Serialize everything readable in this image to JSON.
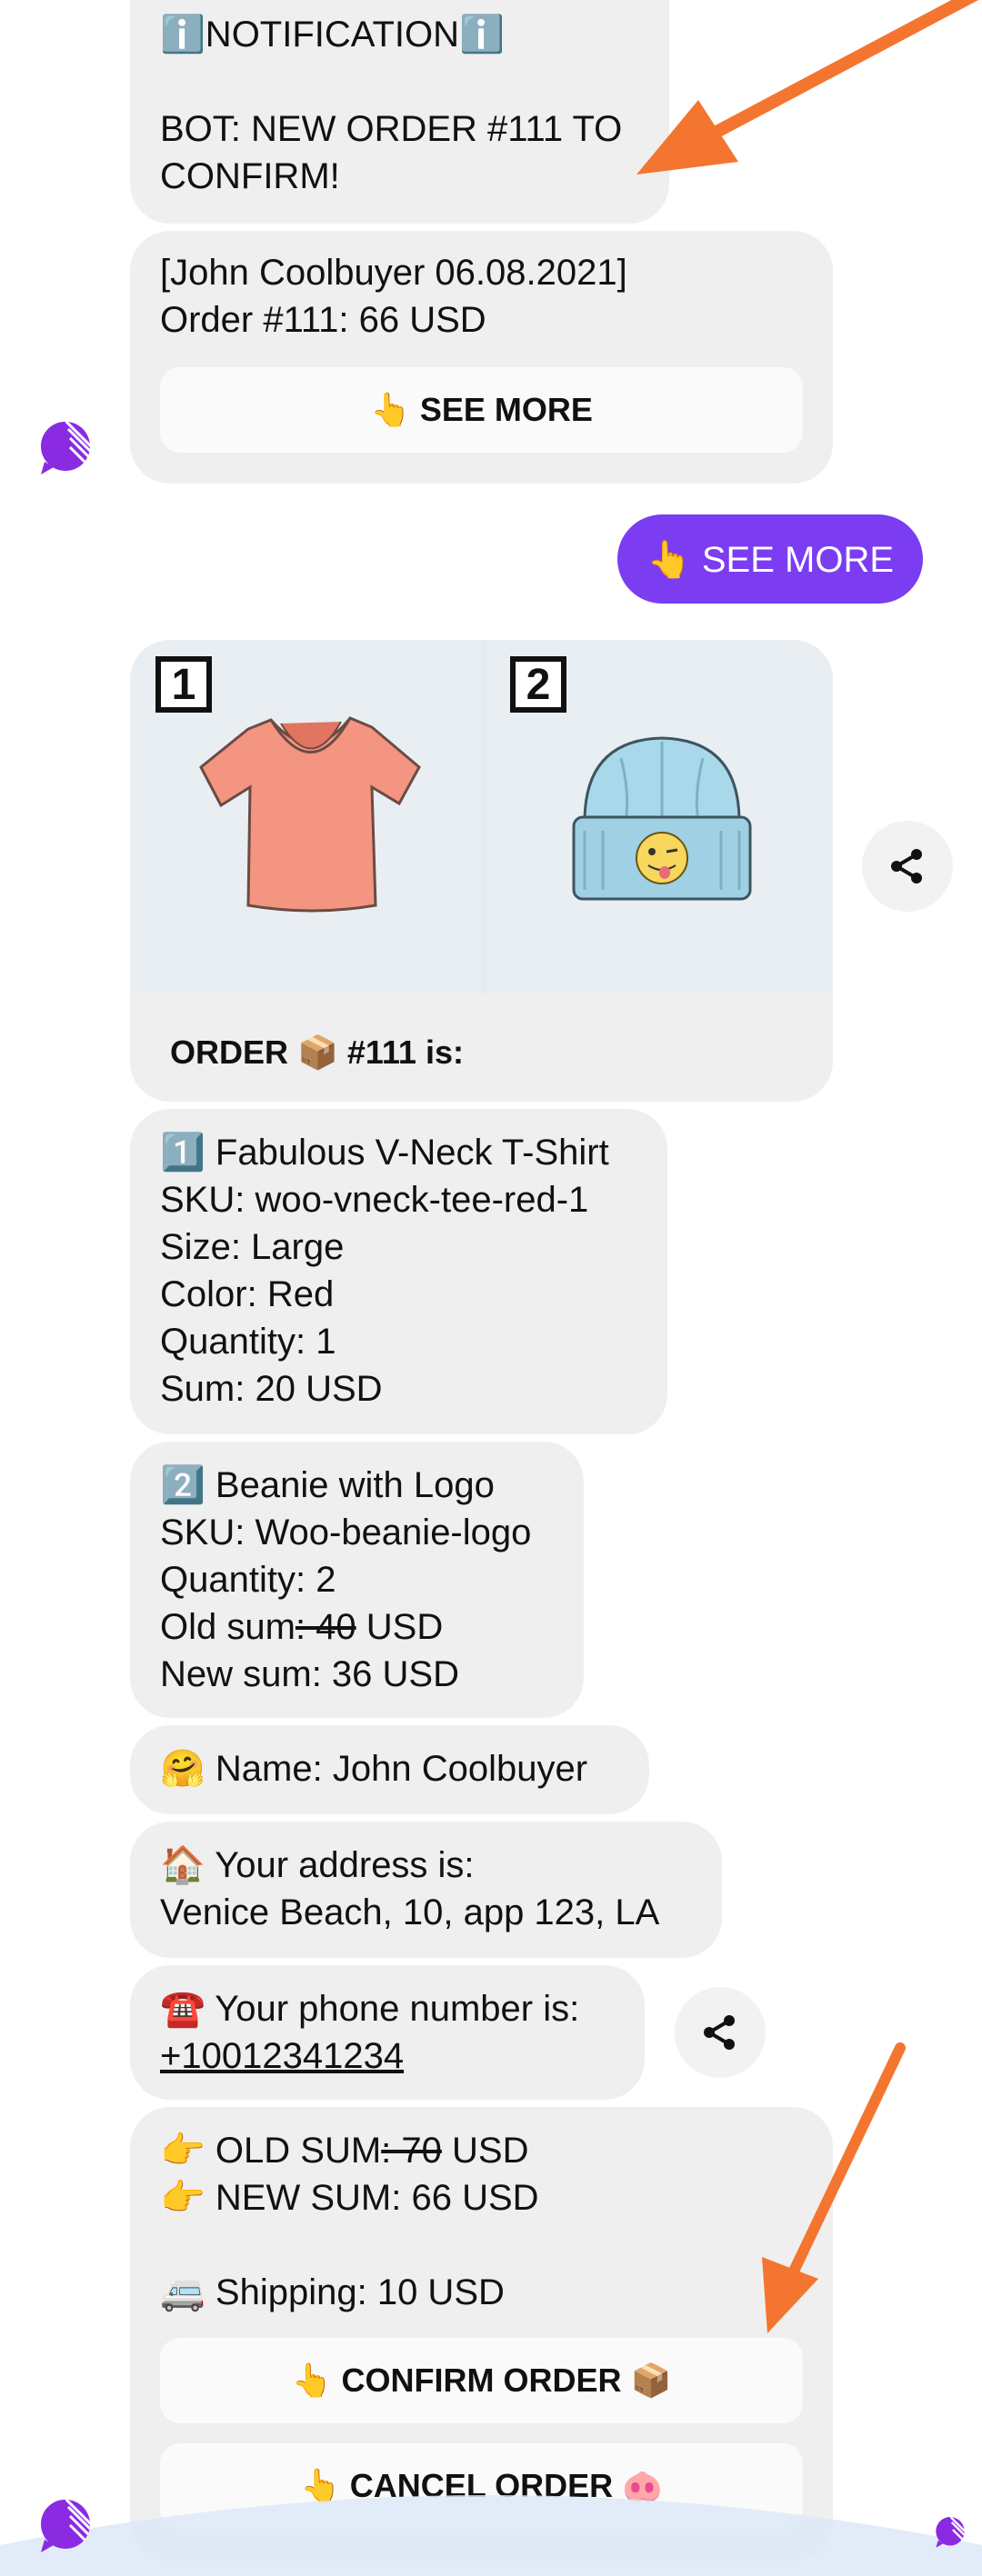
{
  "notification": {
    "header": "ℹ️NOTIFICATIONℹ️",
    "text_line1": "BOT: NEW ORDER #111 TO",
    "text_line2": "CONFIRM!"
  },
  "order_card": {
    "line1": "[John Coolbuyer 06.08.2021]",
    "line2": "Order #111: 66 USD",
    "button": "👆 SEE MORE"
  },
  "user_reply": "👆 SEE MORE",
  "gallery": {
    "label_1": "1",
    "label_2": "2",
    "product_1": "t-shirt",
    "product_2": "beanie",
    "caption": "ORDER 📦 #111 is:"
  },
  "item1": {
    "title": "1️⃣ Fabulous V-Neck T-Shirt",
    "sku": "SKU: woo-vneck-tee-red-1",
    "size": "Size: Large",
    "color": "Color: Red",
    "quantity": "Quantity: 1",
    "sum": "Sum: 20 USD"
  },
  "item2": {
    "title": "2️⃣ Beanie with Logo",
    "sku": "SKU: Woo-beanie-logo",
    "quantity": "Quantity: 2",
    "old_sum_prefix": "Old sum",
    "old_sum_value": ": 40",
    "old_sum_suffix": " USD",
    "new_sum": "New sum: 36 USD"
  },
  "name_msg": "🤗 Name: John Coolbuyer",
  "address": {
    "line1": "🏠 Your address is:",
    "line2": "Venice Beach, 10, app 123, LA"
  },
  "phone": {
    "line1": "☎️ Your phone number is:",
    "number": "+10012341234"
  },
  "summary": {
    "old_sum_prefix": "👉 OLD SUM",
    "old_sum_value": ": 70",
    "old_sum_suffix": " USD",
    "new_sum": "👉 NEW SUM: 66 USD",
    "shipping": "🚐 Shipping: 10 USD",
    "confirm_button": "👆 CONFIRM ORDER 📦",
    "cancel_button": "👆 CANCEL ORDER 🐽"
  },
  "colors": {
    "accent": "#7b3cf2",
    "bubble_bg": "#efefef",
    "annotation_arrow": "#f47530"
  }
}
